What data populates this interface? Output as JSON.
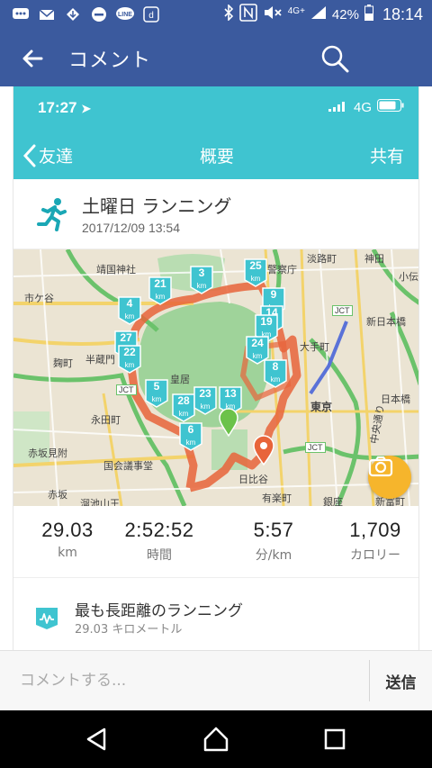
{
  "status_bar": {
    "battery": "42%",
    "network": "4G+",
    "time": "18:14",
    "icons": [
      "chat-icon",
      "mail-icon",
      "download-icon",
      "do-not-disturb-icon",
      "line-icon",
      "app-icon",
      "bluetooth-icon",
      "nfc-icon",
      "mute-icon",
      "signal-icon",
      "battery-icon"
    ]
  },
  "app_bar": {
    "title": "コメント"
  },
  "post": {
    "inner_status": {
      "time": "17:27",
      "network": "4G"
    },
    "inner_nav": {
      "back_label": "友達",
      "title": "概要",
      "share_label": "共有"
    },
    "activity": {
      "title": "土曜日 ランニング",
      "datetime": "2017/12/09 13:54"
    },
    "map": {
      "labels": {
        "yasukuni": "靖国神社",
        "ichigaya": "市ケ谷",
        "kojimachi": "麹町",
        "hanzomon": "半蔵門",
        "kokyo": "皇居",
        "nagatacho": "永田町",
        "akasakamitsuke": "赤坂見附",
        "kokkai": "国会議事堂",
        "akasaka": "赤坂",
        "tameike": "溜池山王",
        "awajicho": "淡路町",
        "kanda": "神田",
        "otemachi": "大手町",
        "shinnihonbashi": "新日本橋",
        "tokyo": "東京",
        "nihonbashi": "日本橋",
        "hibiya": "日比谷",
        "yurakucho": "有楽町",
        "ginza": "銀座",
        "shintomi": "新富町",
        "chuodori": "中央通り",
        "keisatsucho": "警察庁",
        "kodenmacho": "小伝",
        "jct1": "JCT",
        "jct2": "JCT",
        "jct3": "JCT"
      },
      "markers": [
        {
          "label": "3",
          "unit": "km"
        },
        {
          "label": "25",
          "unit": "km"
        },
        {
          "label": "21",
          "unit": "km"
        },
        {
          "label": "4",
          "unit": "km"
        },
        {
          "label": "9",
          "unit": "km"
        },
        {
          "label": "14",
          "unit": "km"
        },
        {
          "label": "19",
          "unit": "km"
        },
        {
          "label": "24",
          "unit": "km"
        },
        {
          "label": "8",
          "unit": "km"
        },
        {
          "label": "27",
          "unit": "km"
        },
        {
          "label": "22",
          "unit": "km"
        },
        {
          "label": "5",
          "unit": "km"
        },
        {
          "label": "28",
          "unit": "km"
        },
        {
          "label": "23",
          "unit": "km"
        },
        {
          "label": "13",
          "unit": "km"
        },
        {
          "label": "6",
          "unit": "km"
        }
      ]
    },
    "stats": [
      {
        "value": "29.03",
        "unit": "km"
      },
      {
        "value": "2:52:52",
        "unit": "時間"
      },
      {
        "value": "5:57",
        "unit": "分/km"
      },
      {
        "value": "1,709",
        "unit": "カロリー"
      }
    ],
    "achievement": {
      "title": "最も長距離のランニング",
      "subtitle": "29.03 キロメートル"
    }
  },
  "comment_bar": {
    "placeholder": "コメントする...",
    "send_label": "送信"
  },
  "colors": {
    "app_bar": "#3b5a9e",
    "inner_header": "#3fc4d0",
    "route": "#e8643a",
    "marker": "#3fc4d0",
    "camera": "#f6b52c"
  }
}
